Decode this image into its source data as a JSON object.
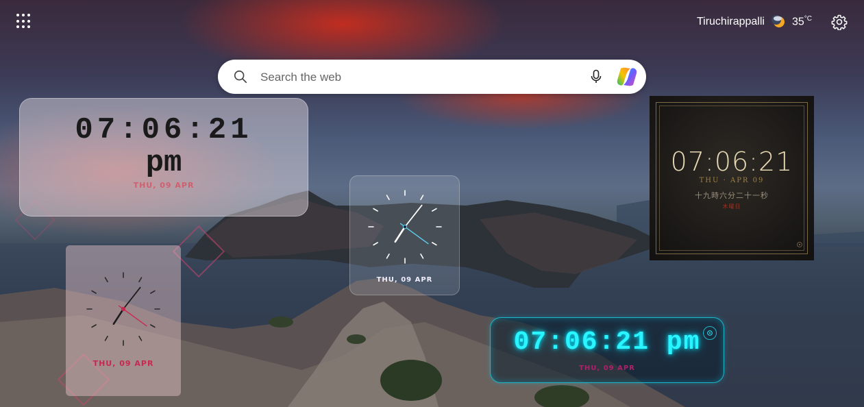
{
  "topbar": {
    "apps_icon": "apps-grid-icon",
    "location": "Tiruchirappalli",
    "weather_icon": "moon-cloud-icon",
    "temperature": "35",
    "temperature_unit": "°C",
    "settings_icon": "gear-icon"
  },
  "search": {
    "placeholder": "Search the web",
    "value": "",
    "icons": [
      "search-icon",
      "microphone-icon",
      "copilot-icon"
    ]
  },
  "widgets": {
    "glass_digital": {
      "time": "07:06:21",
      "ampm": "pm",
      "date": "THU, 09 APR",
      "date_color": "#d06070"
    },
    "pink_analog": {
      "date": "THU, 09 APR",
      "accent": "#c82850",
      "hours": 7,
      "minutes": 6,
      "seconds": 21
    },
    "glass_analog": {
      "date": "THU, 09 APR",
      "accent": "#5fd0f0",
      "hours": 7,
      "minutes": 6,
      "seconds": 21
    },
    "gold_classic": {
      "time": "07:06:21",
      "date": "THU · APR 09",
      "chinese_time": "十九時六分二十一秒",
      "chinese_day": "木曜日",
      "accent": "#a08040"
    },
    "neon_digital": {
      "time": "07:06:21 pm",
      "date": "THU, 09 APR",
      "accent": "#2af4ff"
    }
  }
}
